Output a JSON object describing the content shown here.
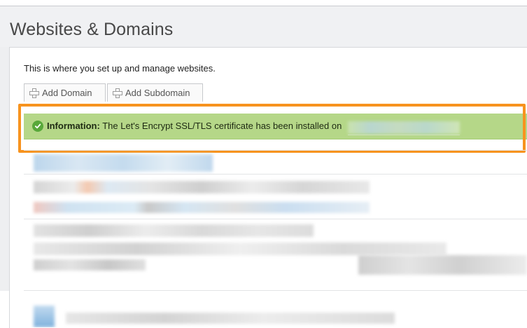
{
  "page": {
    "title": "Websites & Domains",
    "intro": "This is where you set up and manage websites."
  },
  "toolbar": {
    "add_domain_label": "Add Domain",
    "add_subdomain_label": "Add Subdomain"
  },
  "message": {
    "type_label": "Information:",
    "text": "The Let's Encrypt SSL/TLS certificate has been installed on",
    "icon": "check-circle-icon"
  },
  "colors": {
    "message_bg": "#b5d788",
    "highlight_border": "#f7931e",
    "success_icon": "#58a83a"
  }
}
